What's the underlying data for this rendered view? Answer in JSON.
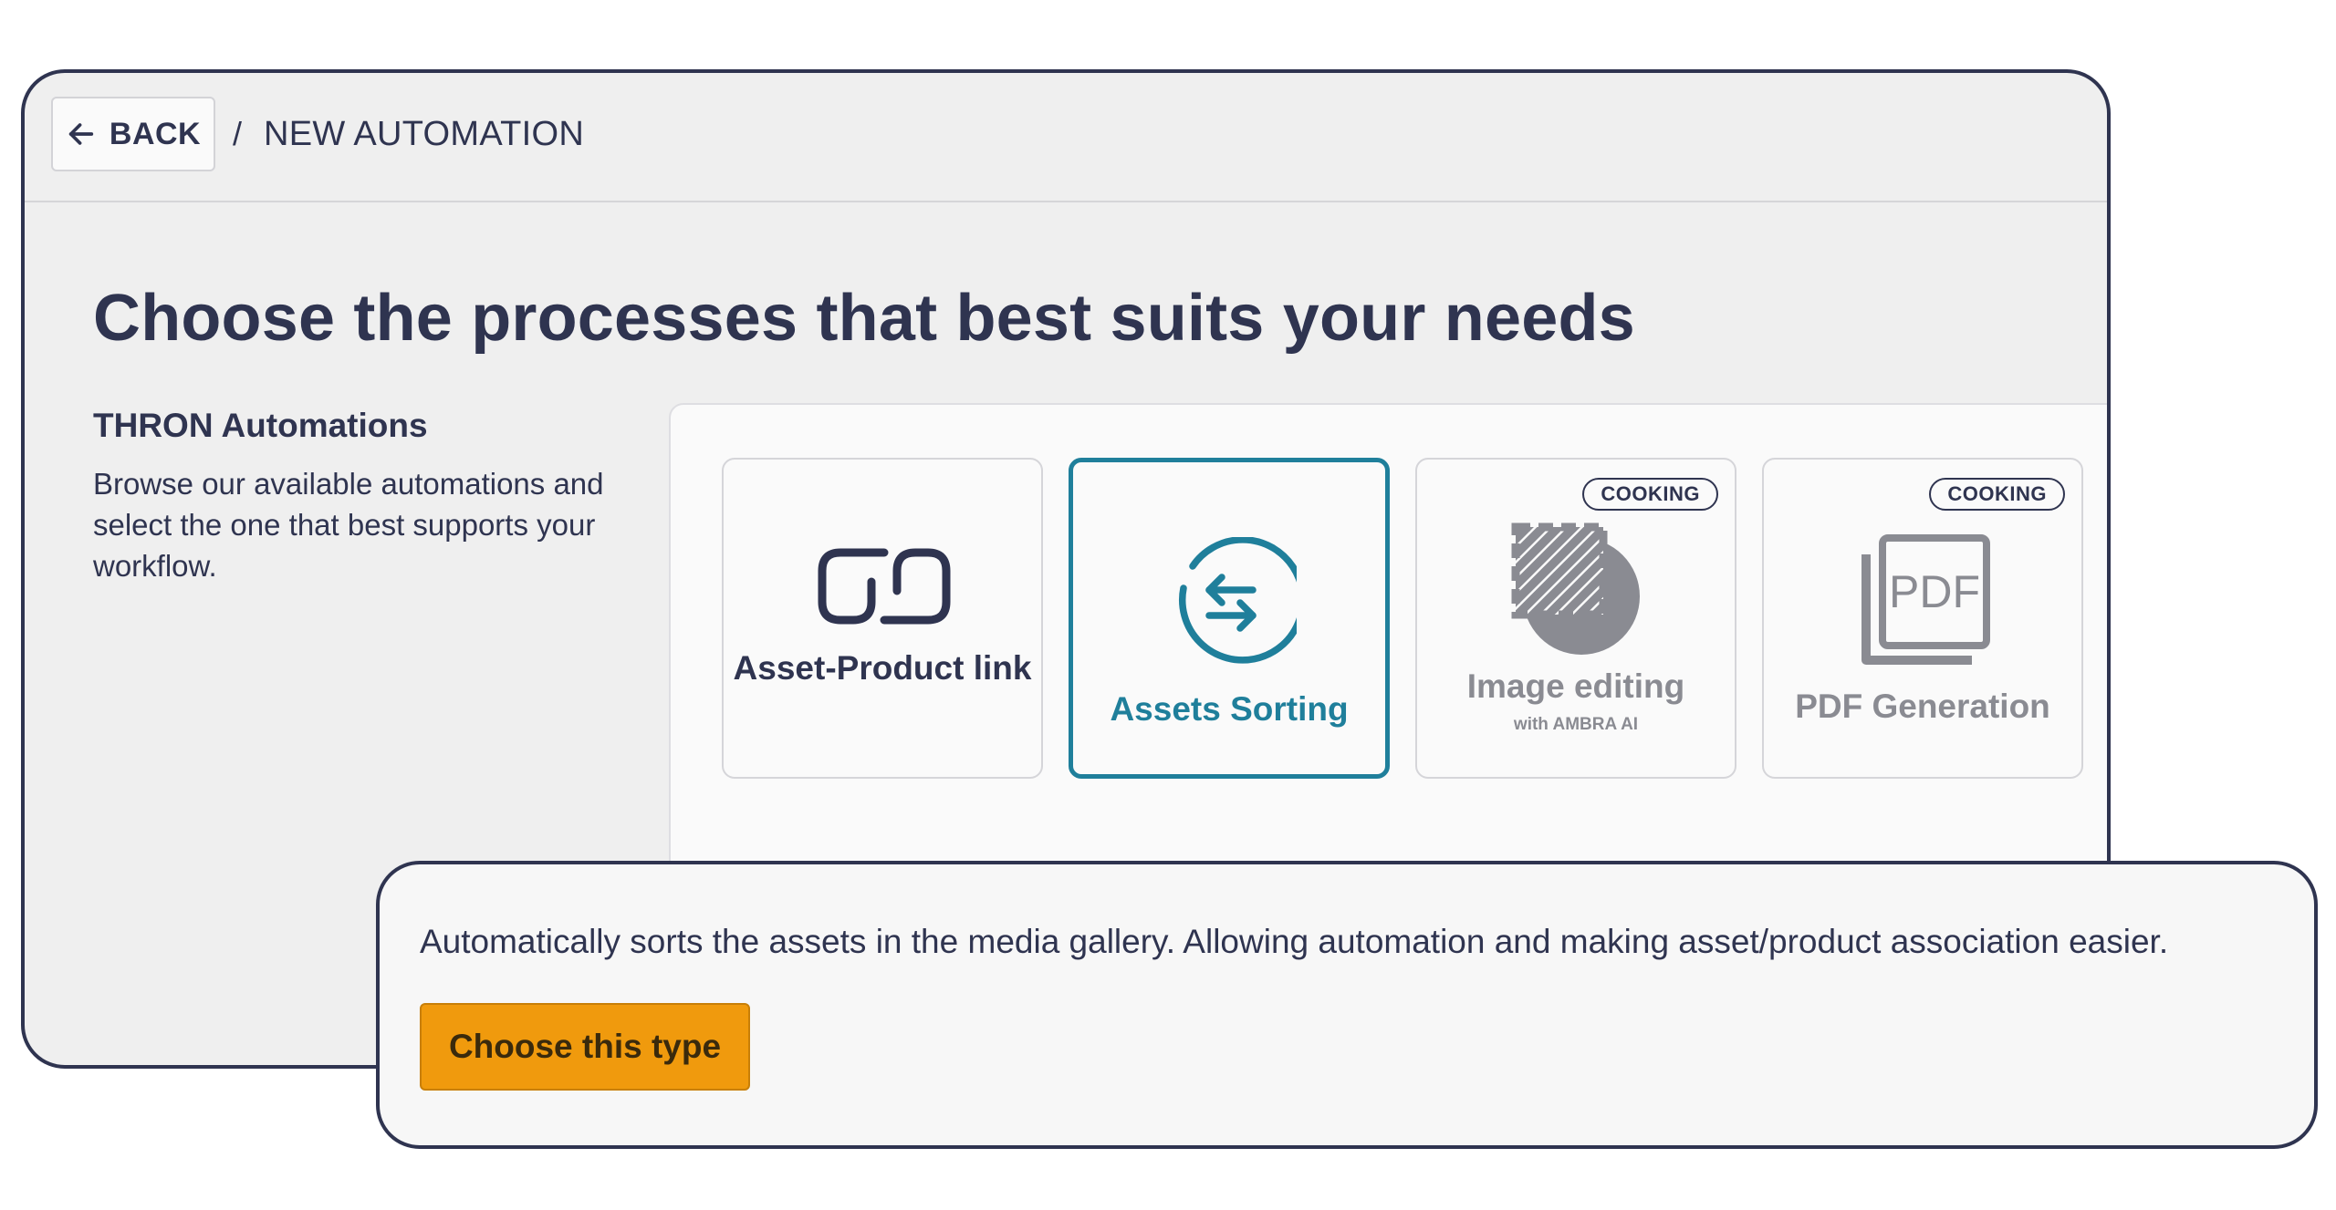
{
  "header": {
    "back_label": "BACK",
    "separator": "/",
    "current_page": "NEW AUTOMATION"
  },
  "page_title": "Choose the processes that best suits your needs",
  "section": {
    "title": "THRON Automations",
    "description": "Browse our available automations and select the one that best supports your workflow."
  },
  "cards": [
    {
      "label": "Asset-Product link",
      "icon": "link-icon",
      "selected": false,
      "badge": ""
    },
    {
      "label": "Assets Sorting",
      "icon": "sort-arrows-icon",
      "selected": true,
      "badge": ""
    },
    {
      "label": "Image editing",
      "sublabel": "with AMBRA AI",
      "icon": "image-editing-icon",
      "selected": false,
      "badge": "COOKING"
    },
    {
      "label": "PDF Generation",
      "icon": "pdf-icon",
      "icon_text": "PDF",
      "selected": false,
      "badge": "COOKING"
    }
  ],
  "info": {
    "description": "Automatically sorts the assets in the media gallery. Allowing automation and making asset/product association easier.",
    "button_label": "Choose this type"
  },
  "colors": {
    "text_primary": "#2f3450",
    "accent_teal": "#1f7f9b",
    "disabled_gray": "#8a8b92",
    "cta_orange": "#f09a0d"
  }
}
